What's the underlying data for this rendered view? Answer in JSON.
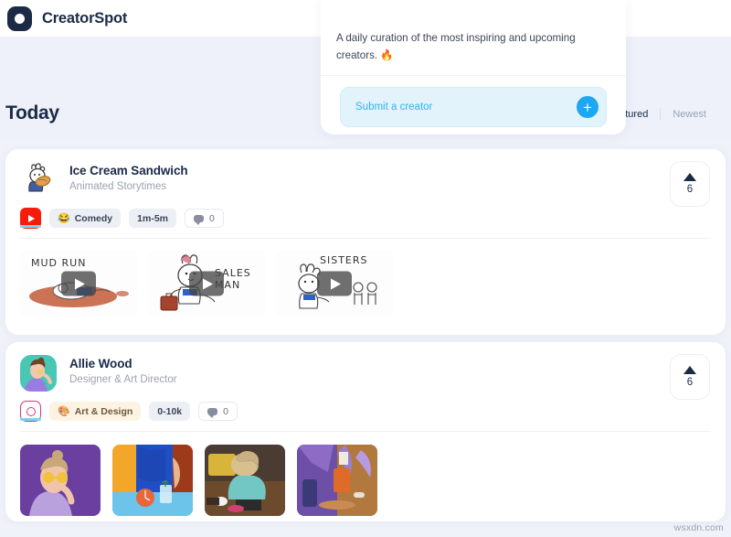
{
  "brand": {
    "name": "CreatorSpot",
    "logo_icon": "circle-dot-logo"
  },
  "hero": {
    "section_title": "Today",
    "promo": {
      "description": "A daily curation of the most inspiring and upcoming creators. 🔥",
      "submit_placeholder": "Submit a creator",
      "add_icon": "plus-icon",
      "accent_color": "#1ca7f0",
      "field_bg": "#e2f3fb"
    },
    "tabs": [
      {
        "label": "Featured",
        "active": true
      },
      {
        "label": "Newest",
        "active": false
      }
    ]
  },
  "cards": [
    {
      "name": "Ice Cream Sandwich",
      "role": "Animated Storytimes",
      "avatar_icon": "cartoon-bunny-avatar",
      "platform": "youtube",
      "platform_icon": "youtube-icon",
      "category": {
        "label": "Comedy",
        "emoji": "😂",
        "style": "comedy"
      },
      "length": "1m-5m",
      "comments": "0",
      "comment_icon": "comment-bubble-icon",
      "votes": "6",
      "vote_icon": "upvote-caret-icon",
      "thumbnails": [
        {
          "title": "MUD  RUN",
          "play_icon": "play-icon"
        },
        {
          "title": "SALES\nMAN",
          "play_icon": "play-icon"
        },
        {
          "title": "SISTERS",
          "play_icon": "play-icon"
        }
      ]
    },
    {
      "name": "Allie Wood",
      "role": "Designer & Art Director",
      "avatar_icon": "photo-portrait-avatar",
      "platform": "instagram",
      "platform_icon": "instagram-icon",
      "category": {
        "label": "Art & Design",
        "emoji": "🎨",
        "style": "art"
      },
      "length": "0-10k",
      "comments": "0",
      "comment_icon": "comment-bubble-icon",
      "votes": "6",
      "vote_icon": "upvote-caret-icon",
      "thumbnails": [
        {
          "title": "",
          "play_icon": ""
        },
        {
          "title": "",
          "play_icon": ""
        },
        {
          "title": "",
          "play_icon": ""
        },
        {
          "title": "",
          "play_icon": ""
        }
      ]
    }
  ],
  "watermark": "wsxdn.com"
}
